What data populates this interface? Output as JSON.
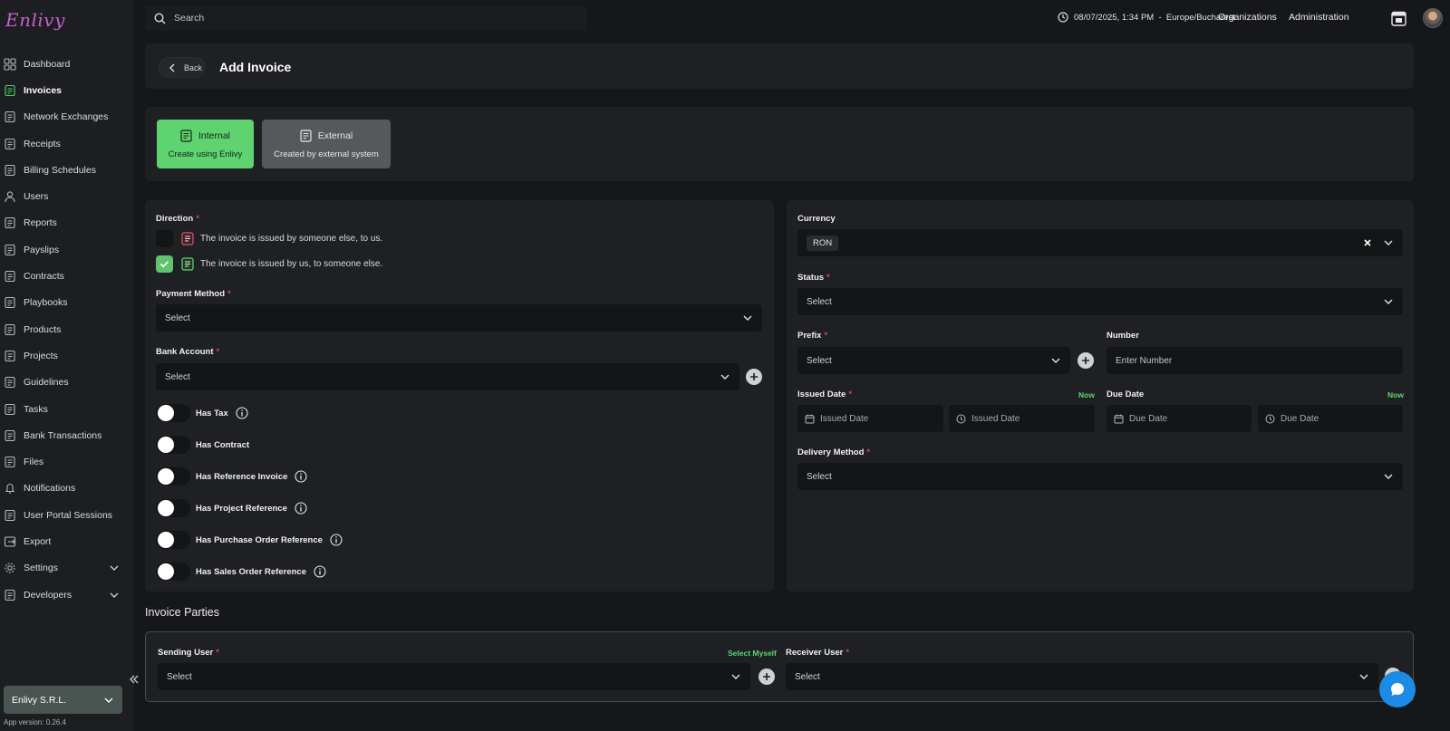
{
  "app": {
    "logo": "Enlivy",
    "version": "App version: 0.26.4",
    "org": "Enlivy S.R.L."
  },
  "sidebar": {
    "items": [
      {
        "label": "Dashboard",
        "icon": "dashboard-icon"
      },
      {
        "label": "Invoices",
        "icon": "invoice-icon",
        "active": true
      },
      {
        "label": "Network Exchanges",
        "icon": "exchange-icon"
      },
      {
        "label": "Receipts",
        "icon": "receipt-icon"
      },
      {
        "label": "Billing Schedules",
        "icon": "calendar-icon"
      },
      {
        "label": "Users",
        "icon": "users-icon"
      },
      {
        "label": "Reports",
        "icon": "reports-icon"
      },
      {
        "label": "Payslips",
        "icon": "payslip-icon"
      },
      {
        "label": "Contracts",
        "icon": "contract-icon"
      },
      {
        "label": "Playbooks",
        "icon": "playbook-icon"
      },
      {
        "label": "Products",
        "icon": "product-icon"
      },
      {
        "label": "Projects",
        "icon": "project-icon"
      },
      {
        "label": "Guidelines",
        "icon": "guideline-icon"
      },
      {
        "label": "Tasks",
        "icon": "task-icon"
      },
      {
        "label": "Bank Transactions",
        "icon": "bank-icon"
      },
      {
        "label": "Files",
        "icon": "file-icon"
      },
      {
        "label": "Notifications",
        "icon": "bell-icon"
      },
      {
        "label": "User Portal Sessions",
        "icon": "portal-icon"
      },
      {
        "label": "Export",
        "icon": "export-icon"
      },
      {
        "label": "Settings",
        "icon": "gear-icon",
        "expandable": true
      },
      {
        "label": "Developers",
        "icon": "developer-icon",
        "expandable": true
      }
    ]
  },
  "topbar": {
    "search_placeholder": "Search",
    "datetime": "08/07/2025, 1:34 PM  -  Europe/Bucharest",
    "organizations": "Organizations",
    "administration": "Administration"
  },
  "header": {
    "back": "Back",
    "title": "Add Invoice"
  },
  "invoice_type": {
    "internal": {
      "title": "Internal",
      "subtitle": "Create using Enlivy"
    },
    "external": {
      "title": "External",
      "subtitle": "Created by external system"
    }
  },
  "form": {
    "direction": {
      "label": "Direction",
      "option_incoming": "The invoice is issued by someone else, to us.",
      "option_outgoing": "The invoice is issued by us, to someone else."
    },
    "payment_method": {
      "label": "Payment Method",
      "value": "Select"
    },
    "bank_account": {
      "label": "Bank Account",
      "value": "Select"
    },
    "toggles": {
      "has_tax": "Has Tax",
      "has_contract": "Has Contract",
      "has_reference_invoice": "Has Reference Invoice",
      "has_project_reference": "Has Project Reference",
      "has_purchase_order_reference": "Has Purchase Order Reference",
      "has_sales_order_reference": "Has Sales Order Reference"
    },
    "currency": {
      "label": "Currency",
      "value": "RON"
    },
    "status": {
      "label": "Status",
      "value": "Select"
    },
    "prefix": {
      "label": "Prefix",
      "value": "Select"
    },
    "number": {
      "label": "Number",
      "placeholder": "Enter Number"
    },
    "issued_date": {
      "label": "Issued Date",
      "now": "Now",
      "placeholder_date": "Issued Date",
      "placeholder_time": "Issued Date"
    },
    "due_date": {
      "label": "Due Date",
      "now": "Now",
      "placeholder_date": "Due Date",
      "placeholder_time": "Due Date"
    },
    "delivery_method": {
      "label": "Delivery Method",
      "value": "Select"
    }
  },
  "parties": {
    "title": "Invoice Parties",
    "sending_user": {
      "label": "Sending User",
      "select_myself": "Select Myself",
      "value": "Select"
    },
    "receiver_user": {
      "label": "Receiver User",
      "value": "Select"
    }
  },
  "colors": {
    "accent": "#5ed36f",
    "required": "#d2464e",
    "chat": "#1b8be6"
  }
}
